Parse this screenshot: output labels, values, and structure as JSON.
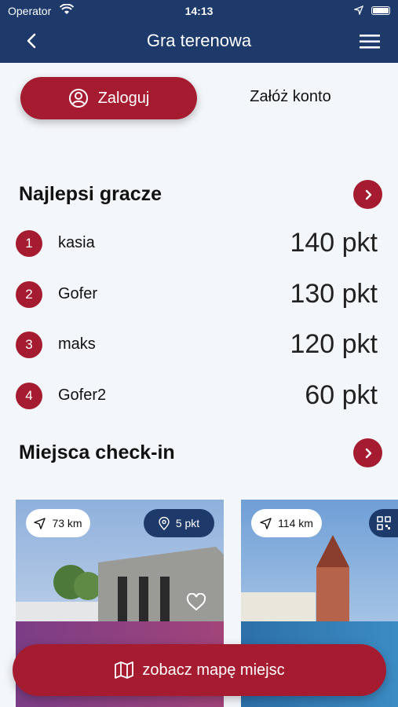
{
  "status_bar": {
    "carrier": "Operator",
    "time": "14:13"
  },
  "nav": {
    "title": "Gra terenowa"
  },
  "auth": {
    "login_label": "Zaloguj",
    "register_label": "Załóż konto"
  },
  "top_players": {
    "title": "Najlepsi gracze",
    "players": [
      {
        "rank": "1",
        "name": "kasia",
        "points": "140 pkt"
      },
      {
        "rank": "2",
        "name": "Gofer",
        "points": "130 pkt"
      },
      {
        "rank": "3",
        "name": "maks",
        "points": "120 pkt"
      },
      {
        "rank": "4",
        "name": "Gofer2",
        "points": "60 pkt"
      }
    ]
  },
  "checkin": {
    "title": "Miejsca check-in",
    "cards": [
      {
        "distance": "73 km",
        "points": "5 pkt"
      },
      {
        "distance": "114 km"
      }
    ]
  },
  "cta": {
    "label": "zobacz mapę miejsc"
  },
  "colors": {
    "navy": "#1d3a6b",
    "accent": "#a51c30",
    "background": "#f3f6fa"
  }
}
